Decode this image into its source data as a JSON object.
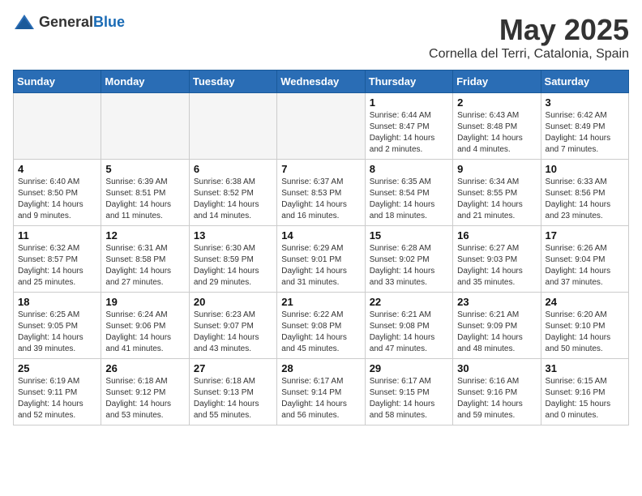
{
  "header": {
    "logo_general": "General",
    "logo_blue": "Blue",
    "month_title": "May 2025",
    "location": "Cornella del Terri, Catalonia, Spain"
  },
  "days_of_week": [
    "Sunday",
    "Monday",
    "Tuesday",
    "Wednesday",
    "Thursday",
    "Friday",
    "Saturday"
  ],
  "weeks": [
    [
      {
        "day": "",
        "info": ""
      },
      {
        "day": "",
        "info": ""
      },
      {
        "day": "",
        "info": ""
      },
      {
        "day": "",
        "info": ""
      },
      {
        "day": "1",
        "info": "Sunrise: 6:44 AM\nSunset: 8:47 PM\nDaylight: 14 hours\nand 2 minutes."
      },
      {
        "day": "2",
        "info": "Sunrise: 6:43 AM\nSunset: 8:48 PM\nDaylight: 14 hours\nand 4 minutes."
      },
      {
        "day": "3",
        "info": "Sunrise: 6:42 AM\nSunset: 8:49 PM\nDaylight: 14 hours\nand 7 minutes."
      }
    ],
    [
      {
        "day": "4",
        "info": "Sunrise: 6:40 AM\nSunset: 8:50 PM\nDaylight: 14 hours\nand 9 minutes."
      },
      {
        "day": "5",
        "info": "Sunrise: 6:39 AM\nSunset: 8:51 PM\nDaylight: 14 hours\nand 11 minutes."
      },
      {
        "day": "6",
        "info": "Sunrise: 6:38 AM\nSunset: 8:52 PM\nDaylight: 14 hours\nand 14 minutes."
      },
      {
        "day": "7",
        "info": "Sunrise: 6:37 AM\nSunset: 8:53 PM\nDaylight: 14 hours\nand 16 minutes."
      },
      {
        "day": "8",
        "info": "Sunrise: 6:35 AM\nSunset: 8:54 PM\nDaylight: 14 hours\nand 18 minutes."
      },
      {
        "day": "9",
        "info": "Sunrise: 6:34 AM\nSunset: 8:55 PM\nDaylight: 14 hours\nand 21 minutes."
      },
      {
        "day": "10",
        "info": "Sunrise: 6:33 AM\nSunset: 8:56 PM\nDaylight: 14 hours\nand 23 minutes."
      }
    ],
    [
      {
        "day": "11",
        "info": "Sunrise: 6:32 AM\nSunset: 8:57 PM\nDaylight: 14 hours\nand 25 minutes."
      },
      {
        "day": "12",
        "info": "Sunrise: 6:31 AM\nSunset: 8:58 PM\nDaylight: 14 hours\nand 27 minutes."
      },
      {
        "day": "13",
        "info": "Sunrise: 6:30 AM\nSunset: 8:59 PM\nDaylight: 14 hours\nand 29 minutes."
      },
      {
        "day": "14",
        "info": "Sunrise: 6:29 AM\nSunset: 9:01 PM\nDaylight: 14 hours\nand 31 minutes."
      },
      {
        "day": "15",
        "info": "Sunrise: 6:28 AM\nSunset: 9:02 PM\nDaylight: 14 hours\nand 33 minutes."
      },
      {
        "day": "16",
        "info": "Sunrise: 6:27 AM\nSunset: 9:03 PM\nDaylight: 14 hours\nand 35 minutes."
      },
      {
        "day": "17",
        "info": "Sunrise: 6:26 AM\nSunset: 9:04 PM\nDaylight: 14 hours\nand 37 minutes."
      }
    ],
    [
      {
        "day": "18",
        "info": "Sunrise: 6:25 AM\nSunset: 9:05 PM\nDaylight: 14 hours\nand 39 minutes."
      },
      {
        "day": "19",
        "info": "Sunrise: 6:24 AM\nSunset: 9:06 PM\nDaylight: 14 hours\nand 41 minutes."
      },
      {
        "day": "20",
        "info": "Sunrise: 6:23 AM\nSunset: 9:07 PM\nDaylight: 14 hours\nand 43 minutes."
      },
      {
        "day": "21",
        "info": "Sunrise: 6:22 AM\nSunset: 9:08 PM\nDaylight: 14 hours\nand 45 minutes."
      },
      {
        "day": "22",
        "info": "Sunrise: 6:21 AM\nSunset: 9:08 PM\nDaylight: 14 hours\nand 47 minutes."
      },
      {
        "day": "23",
        "info": "Sunrise: 6:21 AM\nSunset: 9:09 PM\nDaylight: 14 hours\nand 48 minutes."
      },
      {
        "day": "24",
        "info": "Sunrise: 6:20 AM\nSunset: 9:10 PM\nDaylight: 14 hours\nand 50 minutes."
      }
    ],
    [
      {
        "day": "25",
        "info": "Sunrise: 6:19 AM\nSunset: 9:11 PM\nDaylight: 14 hours\nand 52 minutes."
      },
      {
        "day": "26",
        "info": "Sunrise: 6:18 AM\nSunset: 9:12 PM\nDaylight: 14 hours\nand 53 minutes."
      },
      {
        "day": "27",
        "info": "Sunrise: 6:18 AM\nSunset: 9:13 PM\nDaylight: 14 hours\nand 55 minutes."
      },
      {
        "day": "28",
        "info": "Sunrise: 6:17 AM\nSunset: 9:14 PM\nDaylight: 14 hours\nand 56 minutes."
      },
      {
        "day": "29",
        "info": "Sunrise: 6:17 AM\nSunset: 9:15 PM\nDaylight: 14 hours\nand 58 minutes."
      },
      {
        "day": "30",
        "info": "Sunrise: 6:16 AM\nSunset: 9:16 PM\nDaylight: 14 hours\nand 59 minutes."
      },
      {
        "day": "31",
        "info": "Sunrise: 6:15 AM\nSunset: 9:16 PM\nDaylight: 15 hours\nand 0 minutes."
      }
    ]
  ]
}
